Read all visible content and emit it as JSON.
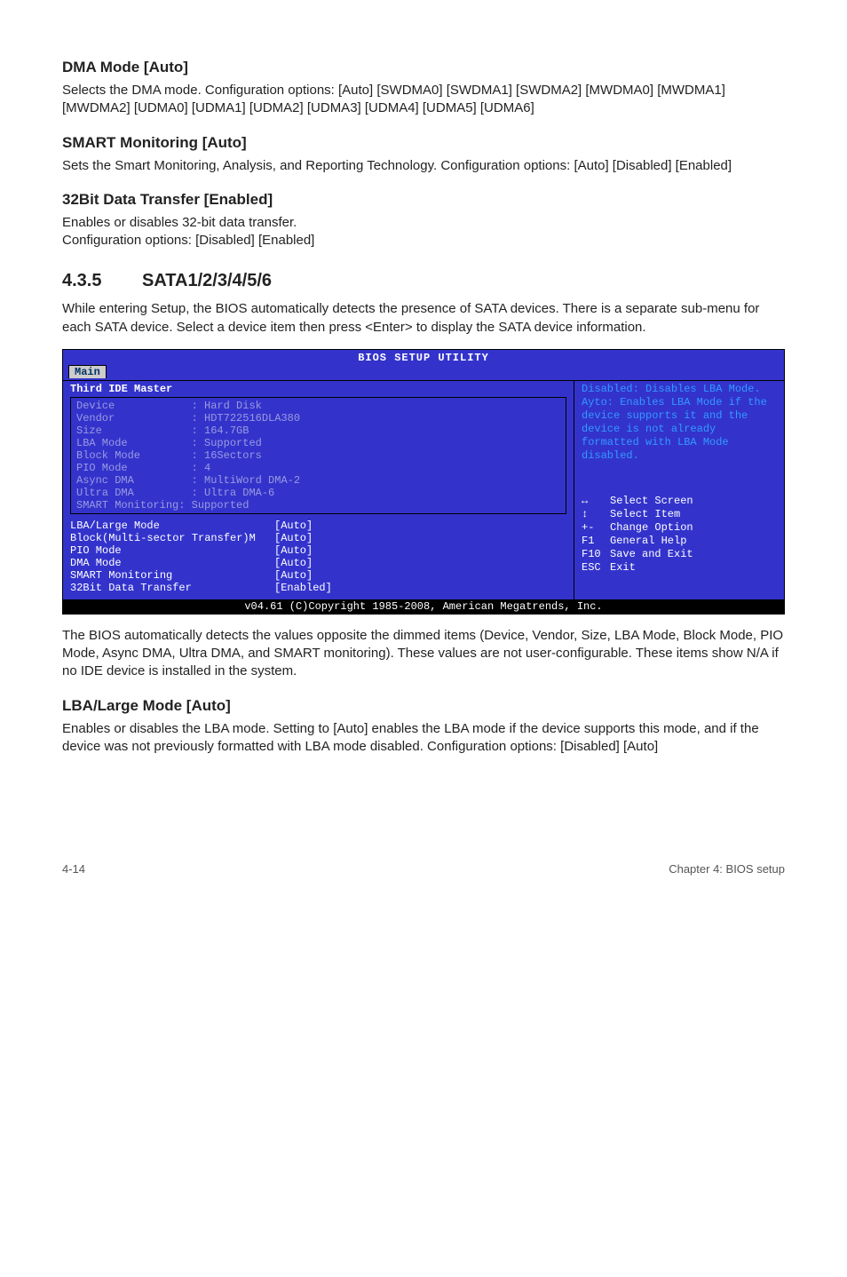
{
  "s1": {
    "h": "DMA Mode [Auto]",
    "p": "Selects the DMA mode. Configuration options: [Auto] [SWDMA0] [SWDMA1] [SWDMA2] [MWDMA0] [MWDMA1] [MWDMA2] [UDMA0] [UDMA1] [UDMA2] [UDMA3] [UDMA4] [UDMA5] [UDMA6]"
  },
  "s2": {
    "h": "SMART Monitoring [Auto]",
    "p": "Sets the Smart Monitoring, Analysis, and Reporting Technology. Configuration options: [Auto] [Disabled] [Enabled]"
  },
  "s3": {
    "h": "32Bit Data Transfer [Enabled]",
    "p1": "Enables or disables 32-bit data transfer.",
    "p2": "Configuration options: [Disabled] [Enabled]"
  },
  "sec": {
    "num": "4.3.5",
    "title": "SATA1/2/3/4/5/6",
    "intro": "While entering Setup, the BIOS automatically detects the presence of SATA devices. There is a separate sub-menu for each SATA device. Select a device item then press <Enter> to display the SATA device information."
  },
  "bios": {
    "title": "BIOS SETUP UTILITY",
    "tab": "Main",
    "subheader": "Third IDE Master",
    "info": {
      "Device": "Hard Disk",
      "Vendor": "HDT722516DLA380",
      "Size": "164.7GB",
      "LBA Mode": "Supported",
      "Block Mode": "16Sectors",
      "PIO Mode": "4",
      "Async DMA": "MultiWord DMA-2",
      "Ultra DMA": "Ultra DMA-6",
      "SMART Monitoring": "Supported"
    },
    "opts": [
      {
        "label": "LBA/Large Mode",
        "val": "[Auto]"
      },
      {
        "label": "Block(Multi-sector Transfer)M",
        "val": "[Auto]"
      },
      {
        "label": "PIO Mode",
        "val": "[Auto]"
      },
      {
        "label": "DMA Mode",
        "val": "[Auto]"
      },
      {
        "label": "SMART Monitoring",
        "val": "[Auto]"
      },
      {
        "label": "32Bit Data Transfer",
        "val": "[Enabled]"
      }
    ],
    "help": "Disabled: Disables LBA Mode.\nAyto: Enables LBA Mode if the device supports it and the device is not already formatted with LBA Mode disabled.",
    "nav": [
      {
        "icon": "↔",
        "text": "Select Screen"
      },
      {
        "icon": "↕",
        "text": "Select Item"
      },
      {
        "icon": "+-",
        "text": "Change Option"
      },
      {
        "icon": "F1",
        "text": "General Help"
      },
      {
        "icon": "F10",
        "text": "Save and Exit"
      },
      {
        "icon": "ESC",
        "text": "Exit"
      }
    ],
    "footer": "v04.61 (C)Copyright 1985-2008, American Megatrends, Inc."
  },
  "after1": "The BIOS automatically detects the values opposite the dimmed items (Device, Vendor, Size, LBA Mode, Block Mode, PIO Mode, Async DMA, Ultra DMA, and SMART monitoring). These values are not user-configurable. These items show N/A if no IDE device is installed in the system.",
  "s4": {
    "h": "LBA/Large Mode [Auto]",
    "p": "Enables or disables the LBA mode. Setting to [Auto] enables the LBA mode if the device supports this mode, and if the device was not previously formatted with LBA mode disabled. Configuration options: [Disabled] [Auto]"
  },
  "footer": {
    "left": "4-14",
    "right": "Chapter 4: BIOS setup"
  }
}
